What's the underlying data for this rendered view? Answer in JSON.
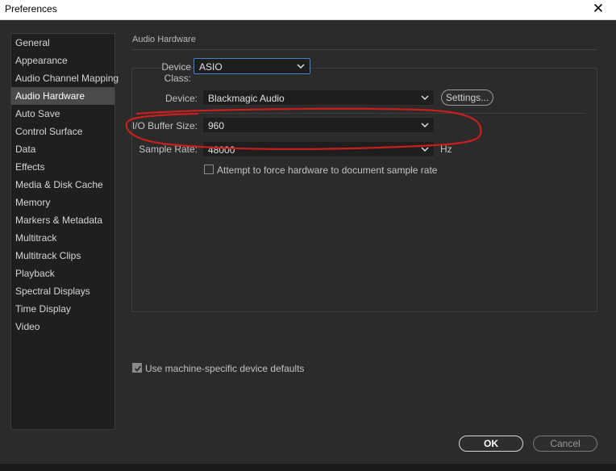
{
  "window": {
    "title": "Preferences",
    "close_glyph": "✕"
  },
  "sidebar": {
    "items": [
      {
        "label": "General"
      },
      {
        "label": "Appearance"
      },
      {
        "label": "Audio Channel Mapping"
      },
      {
        "label": "Audio Hardware",
        "selected": true
      },
      {
        "label": "Auto Save"
      },
      {
        "label": "Control Surface"
      },
      {
        "label": "Data"
      },
      {
        "label": "Effects"
      },
      {
        "label": "Media & Disk Cache"
      },
      {
        "label": "Memory"
      },
      {
        "label": "Markers & Metadata"
      },
      {
        "label": "Multitrack"
      },
      {
        "label": "Multitrack Clips"
      },
      {
        "label": "Playback"
      },
      {
        "label": "Spectral Displays"
      },
      {
        "label": "Time Display"
      },
      {
        "label": "Video"
      }
    ]
  },
  "main": {
    "section_title": "Audio Hardware",
    "device_class": {
      "label": "Device Class:",
      "value": "ASIO"
    },
    "device": {
      "label": "Device:",
      "value": "Blackmagic Audio",
      "settings_label": "Settings..."
    },
    "buffer_size": {
      "label": "I/O Buffer Size:",
      "value": "960"
    },
    "sample_rate": {
      "label": "Sample Rate:",
      "value": "48000",
      "unit": "Hz"
    },
    "force_sample_rate": {
      "label": "Attempt to force hardware to document sample rate",
      "checked": false
    },
    "machine_defaults": {
      "label": "Use machine-specific device defaults",
      "checked": true
    }
  },
  "footer": {
    "ok_label": "OK",
    "cancel_label": "Cancel"
  },
  "colors": {
    "background": "#2b2b2b",
    "sidebar_bg": "#1f1f1f",
    "selected_bg": "#4a4a4a",
    "focus_border": "#4b7fc4",
    "annotation": "#c81e1e"
  }
}
